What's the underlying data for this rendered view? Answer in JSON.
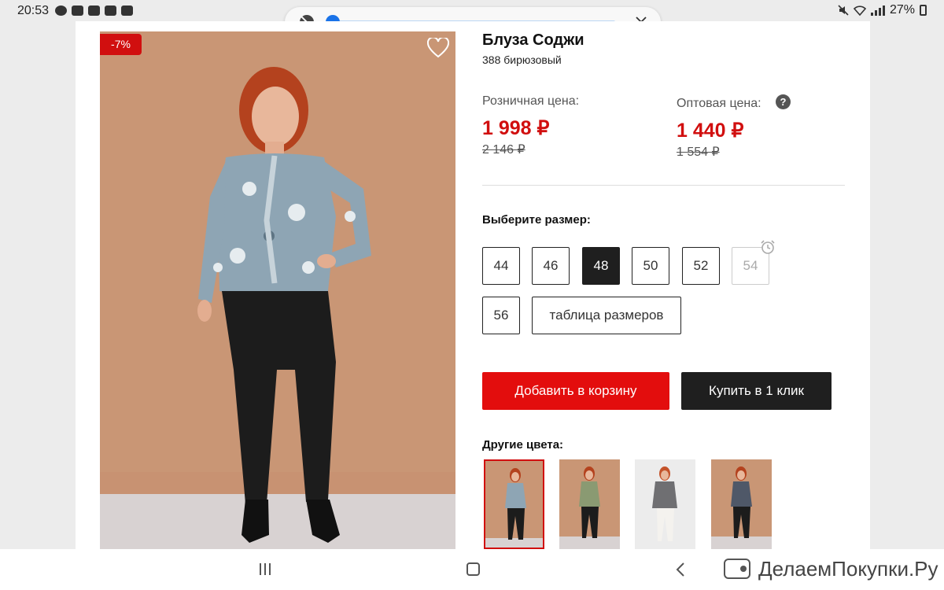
{
  "status_bar": {
    "time": "20:53",
    "battery": "27%",
    "icons": [
      "chat-icon",
      "youtube-icon",
      "notification-icon",
      "youtube-icon",
      "image-icon"
    ]
  },
  "product": {
    "title": "Блуза Соджи",
    "subtitle": "388 бирюзовый",
    "discount_badge": "-7%",
    "retail": {
      "label": "Розничная цена:",
      "price": "1 998 ₽",
      "old_price": "2 146 ₽"
    },
    "wholesale": {
      "label": "Оптовая цена:",
      "price": "1 440 ₽",
      "old_price": "1 554 ₽",
      "help": "?"
    }
  },
  "sizes": {
    "label": "Выберите размер:",
    "options": [
      {
        "value": "44",
        "state": "available"
      },
      {
        "value": "46",
        "state": "available"
      },
      {
        "value": "48",
        "state": "selected"
      },
      {
        "value": "50",
        "state": "available"
      },
      {
        "value": "52",
        "state": "available"
      },
      {
        "value": "54",
        "state": "unavailable"
      },
      {
        "value": "56",
        "state": "available"
      }
    ],
    "table_link": "таблица размеров"
  },
  "actions": {
    "add_to_cart": "Добавить в корзину",
    "buy_one_click": "Купить в 1 клик"
  },
  "other_colors": {
    "label": "Другие цвета:",
    "count": 4,
    "selected_index": 0
  },
  "watermark": "ДелаемПокупки.Ру",
  "colors": {
    "accent_red": "#e30d0d",
    "price_red": "#d10f0f",
    "dark_button": "#1f1f1f",
    "scrubber_blue": "#1a73e8"
  }
}
